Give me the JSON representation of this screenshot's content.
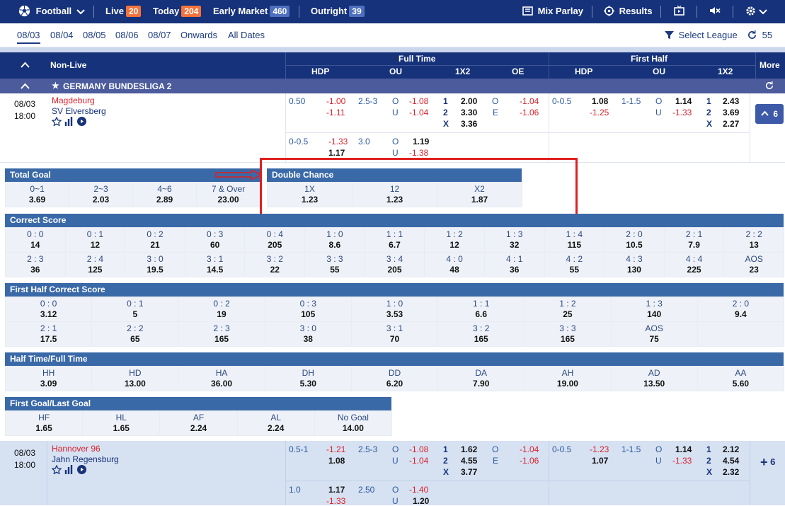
{
  "nav": {
    "sport": "Football",
    "live_label": "Live",
    "live_count": "20",
    "today_label": "Today",
    "today_count": "204",
    "early_label": "Early Market",
    "early_count": "460",
    "outright_label": "Outright",
    "outright_count": "39",
    "mix_parlay": "Mix Parlay",
    "results": "Results"
  },
  "dates": {
    "items": [
      "08/03",
      "08/04",
      "08/05",
      "08/06",
      "08/07",
      "Onwards",
      "All Dates"
    ],
    "select_league": "Select League",
    "refresh_count": "55"
  },
  "header": {
    "nonlive": "Non-Live",
    "full_time": "Full Time",
    "first_half": "First Half",
    "hdp": "HDP",
    "ou": "OU",
    "x12": "1X2",
    "oe": "OE",
    "more": "More"
  },
  "league": {
    "name": "GERMANY BUNDESLIGA 2"
  },
  "match1": {
    "date": "08/03",
    "time": "18:00",
    "home": "Magdeburg",
    "away": "SV Elversberg",
    "more": "6",
    "ft1": {
      "hdp": "0.50",
      "hdp_h": "-1.00",
      "hdp_a": "-1.11",
      "ou": "2.5-3",
      "o": "O",
      "u": "U",
      "ou_o": "-1.08",
      "ou_u": "-1.04",
      "p1": "1",
      "p2": "2",
      "px": "X",
      "x1": "2.00",
      "x2": "3.30",
      "xx": "3.36",
      "oe_o": "O",
      "oe_e": "E",
      "oe_ov": "-1.04",
      "oe_ev": "-1.06"
    },
    "ft2": {
      "hdp": "0-0.5",
      "hdp_h": "-1.33",
      "hdp_a": "1.17",
      "ou": "3.0",
      "o": "O",
      "u": "U",
      "ou_o": "1.19",
      "ou_u": "-1.38"
    },
    "fh1": {
      "hdp": "0-0.5",
      "hdp_h": "1.08",
      "hdp_a": "-1.25",
      "ou": "1-1.5",
      "o": "O",
      "u": "U",
      "ou_o": "1.14",
      "ou_u": "-1.33",
      "p1": "1",
      "p2": "2",
      "px": "X",
      "x1": "2.43",
      "x2": "3.69",
      "xx": "2.27"
    }
  },
  "total_goal": {
    "title": "Total Goal",
    "cells": [
      {
        "l": "0~1",
        "v": "3.69"
      },
      {
        "l": "2~3",
        "v": "2.03"
      },
      {
        "l": "4~6",
        "v": "2.89"
      },
      {
        "l": "7 & Over",
        "v": "23.00"
      }
    ]
  },
  "double_chance": {
    "title": "Double Chance",
    "cells": [
      {
        "l": "1X",
        "v": "1.23"
      },
      {
        "l": "12",
        "v": "1.23"
      },
      {
        "l": "X2",
        "v": "1.87"
      }
    ]
  },
  "correct_score": {
    "title": "Correct Score",
    "cells": [
      {
        "l": "0 : 0",
        "v": "14"
      },
      {
        "l": "0 : 1",
        "v": "12"
      },
      {
        "l": "0 : 2",
        "v": "21"
      },
      {
        "l": "0 : 3",
        "v": "60"
      },
      {
        "l": "0 : 4",
        "v": "205"
      },
      {
        "l": "1 : 0",
        "v": "8.6"
      },
      {
        "l": "1 : 1",
        "v": "6.7"
      },
      {
        "l": "1 : 2",
        "v": "12"
      },
      {
        "l": "1 : 3",
        "v": "32"
      },
      {
        "l": "1 : 4",
        "v": "115"
      },
      {
        "l": "2 : 0",
        "v": "10.5"
      },
      {
        "l": "2 : 1",
        "v": "7.9"
      },
      {
        "l": "2 : 2",
        "v": "13"
      },
      {
        "l": "2 : 3",
        "v": "36"
      },
      {
        "l": "2 : 4",
        "v": "125"
      },
      {
        "l": "3 : 0",
        "v": "19.5"
      },
      {
        "l": "3 : 1",
        "v": "14.5"
      },
      {
        "l": "3 : 2",
        "v": "22"
      },
      {
        "l": "3 : 3",
        "v": "55"
      },
      {
        "l": "3 : 4",
        "v": "205"
      },
      {
        "l": "4 : 0",
        "v": "48"
      },
      {
        "l": "4 : 1",
        "v": "36"
      },
      {
        "l": "4 : 2",
        "v": "55"
      },
      {
        "l": "4 : 3",
        "v": "130"
      },
      {
        "l": "4 : 4",
        "v": "225"
      },
      {
        "l": "AOS",
        "v": "23"
      }
    ]
  },
  "fh_correct_score": {
    "title": "First Half Correct Score",
    "cells": [
      {
        "l": "0 : 0",
        "v": "3.12"
      },
      {
        "l": "0 : 1",
        "v": "5"
      },
      {
        "l": "0 : 2",
        "v": "19"
      },
      {
        "l": "0 : 3",
        "v": "105"
      },
      {
        "l": "1 : 0",
        "v": "3.53"
      },
      {
        "l": "1 : 1",
        "v": "6.6"
      },
      {
        "l": "1 : 2",
        "v": "25"
      },
      {
        "l": "1 : 3",
        "v": "140"
      },
      {
        "l": "2 : 0",
        "v": "9.4"
      },
      {
        "l": "2 : 1",
        "v": "17.5"
      },
      {
        "l": "2 : 2",
        "v": "65"
      },
      {
        "l": "2 : 3",
        "v": "165"
      },
      {
        "l": "3 : 0",
        "v": "38"
      },
      {
        "l": "3 : 1",
        "v": "70"
      },
      {
        "l": "3 : 2",
        "v": "165"
      },
      {
        "l": "3 : 3",
        "v": "165"
      },
      {
        "l": "AOS",
        "v": "75"
      },
      {
        "l": "",
        "v": ""
      }
    ]
  },
  "htft": {
    "title": "Half Time/Full Time",
    "cells": [
      {
        "l": "HH",
        "v": "3.09"
      },
      {
        "l": "HD",
        "v": "13.00"
      },
      {
        "l": "HA",
        "v": "36.00"
      },
      {
        "l": "DH",
        "v": "5.30"
      },
      {
        "l": "DD",
        "v": "6.20"
      },
      {
        "l": "DA",
        "v": "7.90"
      },
      {
        "l": "AH",
        "v": "19.00"
      },
      {
        "l": "AD",
        "v": "13.50"
      },
      {
        "l": "AA",
        "v": "5.60"
      }
    ]
  },
  "fglg": {
    "title": "First Goal/Last Goal",
    "cells": [
      {
        "l": "HF",
        "v": "1.65"
      },
      {
        "l": "HL",
        "v": "1.65"
      },
      {
        "l": "AF",
        "v": "2.24"
      },
      {
        "l": "AL",
        "v": "2.24"
      },
      {
        "l": "No Goal",
        "v": "14.00"
      }
    ]
  },
  "match2": {
    "date": "08/03",
    "time": "18:00",
    "home": "Hannover 96",
    "away": "Jahn Regensburg",
    "more": "6",
    "ft1": {
      "hdp": "0.5-1",
      "hdp_h": "-1.21",
      "hdp_a": "1.08",
      "ou": "2.5-3",
      "o": "O",
      "u": "U",
      "ou_o": "-1.08",
      "ou_u": "-1.04",
      "p1": "1",
      "p2": "2",
      "px": "X",
      "x1": "1.62",
      "x2": "4.55",
      "xx": "3.77",
      "oe_o": "O",
      "oe_e": "E",
      "oe_ov": "-1.04",
      "oe_ev": "-1.06"
    },
    "ft2": {
      "hdp": "1.0",
      "hdp_h": "1.17",
      "hdp_a": "-1.33",
      "ou": "2.50",
      "o": "O",
      "u": "U",
      "ou_o": "-1.40",
      "ou_u": "1.20"
    },
    "fh1": {
      "hdp": "0-0.5",
      "hdp_h": "-1.23",
      "hdp_a": "1.07",
      "ou": "1-1.5",
      "o": "O",
      "u": "U",
      "ou_o": "1.14",
      "ou_u": "-1.33",
      "p1": "1",
      "p2": "2",
      "px": "X",
      "x1": "2.12",
      "x2": "4.54",
      "xx": "2.32"
    }
  }
}
